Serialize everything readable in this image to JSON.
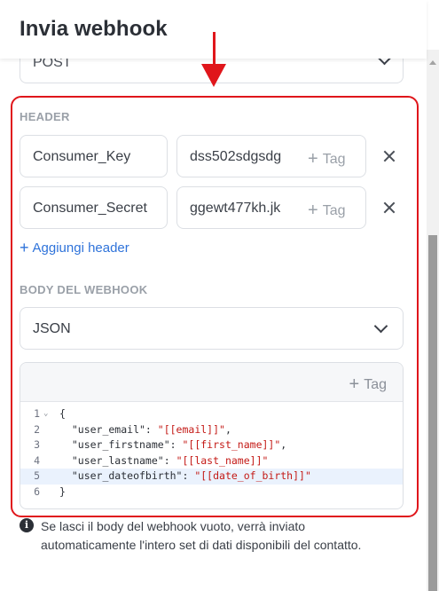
{
  "title": "Invia webhook",
  "method": {
    "value": "POST"
  },
  "headers": {
    "label": "HEADER",
    "rows": [
      {
        "key": "Consumer_Key",
        "value": "dss502sdgsdg",
        "tag_label": "Tag"
      },
      {
        "key": "Consumer_Secret",
        "value": "ggewt477kh.jk",
        "tag_label": "Tag"
      }
    ],
    "add_label": "Aggiungi header"
  },
  "body": {
    "label": "BODY DEL WEBHOOK",
    "format": "JSON",
    "tag_label": "Tag",
    "lines": [
      {
        "no": "1",
        "parts": [
          {
            "t": "{",
            "c": "k"
          }
        ]
      },
      {
        "no": "2",
        "parts": [
          {
            "t": "  \"user_email\": ",
            "c": "k"
          },
          {
            "t": "\"[[email]]\"",
            "c": "s"
          },
          {
            "t": ",",
            "c": "k"
          }
        ]
      },
      {
        "no": "3",
        "parts": [
          {
            "t": "  \"user_firstname\": ",
            "c": "k"
          },
          {
            "t": "\"[[first_name]]\"",
            "c": "s"
          },
          {
            "t": ",",
            "c": "k"
          }
        ]
      },
      {
        "no": "4",
        "parts": [
          {
            "t": "  \"user_lastname\": ",
            "c": "k"
          },
          {
            "t": "\"[[last_name]]\"",
            "c": "s"
          }
        ]
      },
      {
        "no": "5",
        "parts": [
          {
            "t": "  \"user_dateofbirth\": ",
            "c": "k"
          },
          {
            "t": "\"[[date_of_birth]]\"",
            "c": "s"
          }
        ]
      },
      {
        "no": "6",
        "parts": [
          {
            "t": "}",
            "c": "k"
          }
        ]
      }
    ],
    "active_line": 4
  },
  "info_text": "Se lasci il body del webhook vuoto, verrà inviato automaticamente l'intero set di dati disponibili del contatto.",
  "colors": {
    "accent": "#2f73da",
    "highlight": "#e0161b",
    "string": "#c41a16"
  },
  "icons": [
    "chevron-down-icon",
    "plus-icon",
    "close-icon",
    "info-icon",
    "arrow-down-icon"
  ]
}
